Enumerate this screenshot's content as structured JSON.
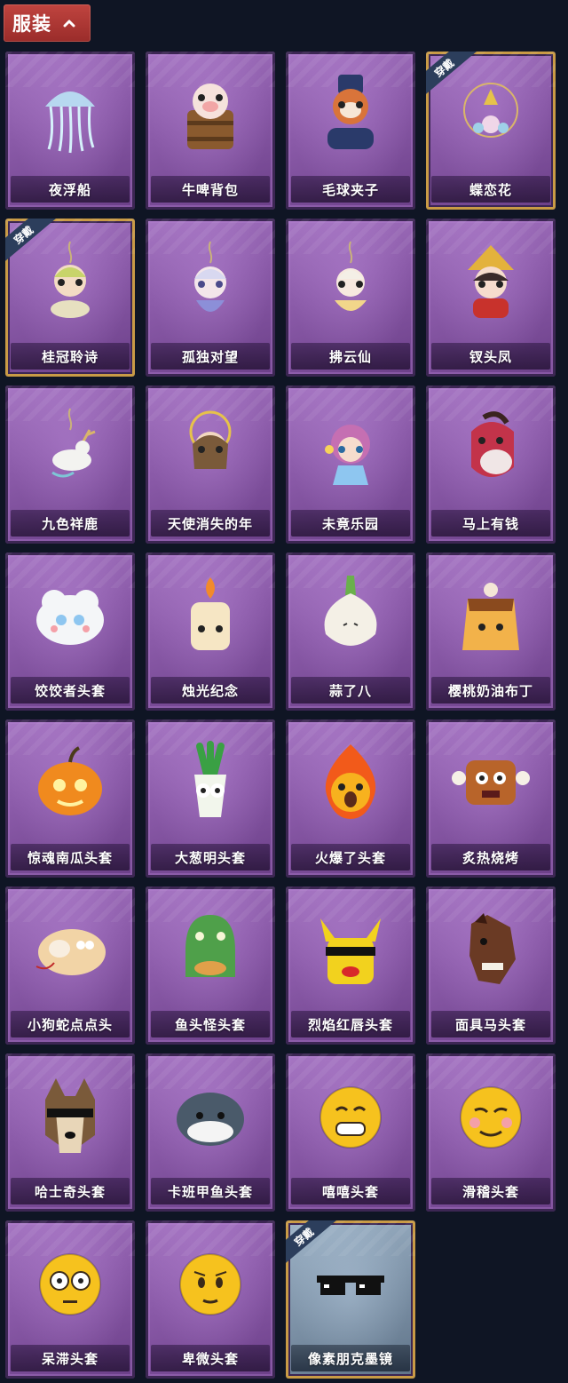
{
  "header": {
    "label": "服装"
  },
  "equipped_badge": "穿戴",
  "colors": {
    "card_purple": "#8a5aa8",
    "card_silver": "#7e93a8",
    "header_red": "#b03a36",
    "equipped_border": "#c99b46",
    "background": "#0f1524"
  },
  "items": [
    {
      "name": "夜浮船",
      "icon": "jellyfish-pendant-icon",
      "equipped": false
    },
    {
      "name": "牛啤背包",
      "icon": "cow-beer-barrel-icon",
      "equipped": false
    },
    {
      "name": "毛球夹子",
      "icon": "raccoon-drummer-icon",
      "equipped": false
    },
    {
      "name": "蝶恋花",
      "icon": "butterfly-flower-pendant-icon",
      "equipped": true
    },
    {
      "name": "桂冠聆诗",
      "icon": "laurel-doll-pendant-icon",
      "equipped": true
    },
    {
      "name": "孤独对望",
      "icon": "lonely-doll-pendant-icon",
      "equipped": false
    },
    {
      "name": "拂云仙",
      "icon": "cloud-fairy-pendant-icon",
      "equipped": false
    },
    {
      "name": "钗头凤",
      "icon": "phoenix-crown-doll-icon",
      "equipped": false
    },
    {
      "name": "九色祥鹿",
      "icon": "deer-pendant-icon",
      "equipped": false
    },
    {
      "name": "天使消失的年",
      "icon": "angel-doll-pendant-icon",
      "equipped": false
    },
    {
      "name": "未竟乐园",
      "icon": "paradise-girl-doll-icon",
      "equipped": false
    },
    {
      "name": "马上有钱",
      "icon": "red-horse-head-icon",
      "equipped": false
    },
    {
      "name": "饺饺者头套",
      "icon": "dumpling-mask-icon",
      "equipped": false
    },
    {
      "name": "烛光纪念",
      "icon": "candle-mask-icon",
      "equipped": false
    },
    {
      "name": "蒜了八",
      "icon": "garlic-mask-icon",
      "equipped": false
    },
    {
      "name": "樱桃奶油布丁",
      "icon": "pudding-mask-icon",
      "equipped": false
    },
    {
      "name": "惊魂南瓜头套",
      "icon": "pumpkin-mask-icon",
      "equipped": false
    },
    {
      "name": "大葱明头套",
      "icon": "scallion-mask-icon",
      "equipped": false
    },
    {
      "name": "火爆了头套",
      "icon": "fire-mask-icon",
      "equipped": false
    },
    {
      "name": "炙热烧烤",
      "icon": "meat-bone-mask-icon",
      "equipped": false
    },
    {
      "name": "小狗蛇点点头",
      "icon": "snake-dog-mask-icon",
      "equipped": false
    },
    {
      "name": "鱼头怪头套",
      "icon": "fish-head-mask-icon",
      "equipped": false
    },
    {
      "name": "烈焰红唇头套",
      "icon": "yellow-sunglasses-mask-icon",
      "equipped": false
    },
    {
      "name": "面具马头套",
      "icon": "horse-mask-icon",
      "equipped": false
    },
    {
      "name": "哈士奇头套",
      "icon": "husky-mask-icon",
      "equipped": false
    },
    {
      "name": "卡班甲鱼头套",
      "icon": "turtle-mask-icon",
      "equipped": false
    },
    {
      "name": "嘻嘻头套",
      "icon": "grin-emoji-mask-icon",
      "equipped": false
    },
    {
      "name": "滑稽头套",
      "icon": "funny-emoji-mask-icon",
      "equipped": false
    },
    {
      "name": "呆滞头套",
      "icon": "dazed-emoji-mask-icon",
      "equipped": false
    },
    {
      "name": "卑微头套",
      "icon": "humble-emoji-mask-icon",
      "equipped": false
    },
    {
      "name": "像素朋克墨镜",
      "icon": "pixel-sunglasses-icon",
      "equipped": true
    }
  ]
}
